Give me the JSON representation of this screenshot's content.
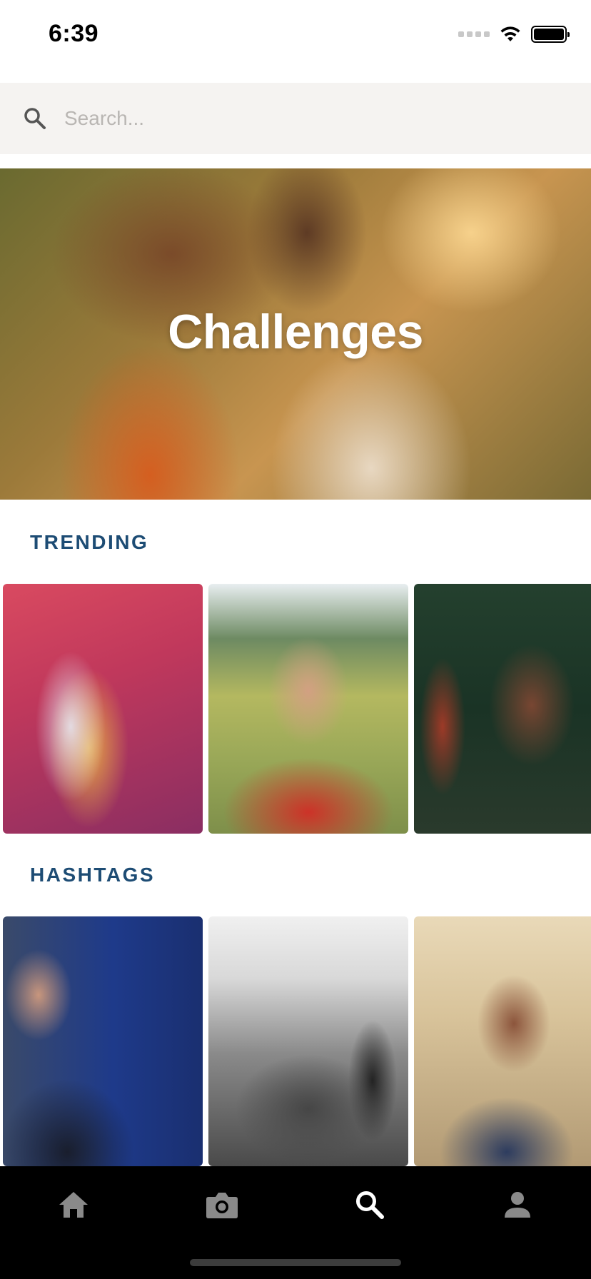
{
  "status_bar": {
    "time": "6:39"
  },
  "search": {
    "placeholder": "Search..."
  },
  "hero": {
    "title": "Challenges"
  },
  "sections": {
    "trending": {
      "title": "TRENDING"
    },
    "hashtags": {
      "title": "HASHTAGS"
    }
  },
  "nav": {
    "items": [
      {
        "icon": "home-icon",
        "active": false
      },
      {
        "icon": "camera-icon",
        "active": false
      },
      {
        "icon": "search-icon",
        "active": true
      },
      {
        "icon": "person-icon",
        "active": false
      }
    ]
  },
  "colors": {
    "section_title": "#1d4c74",
    "search_background": "#f5f3f1",
    "nav_background": "#000000",
    "nav_icon_inactive": "#8a8a8a",
    "nav_icon_active": "#ffffff"
  }
}
